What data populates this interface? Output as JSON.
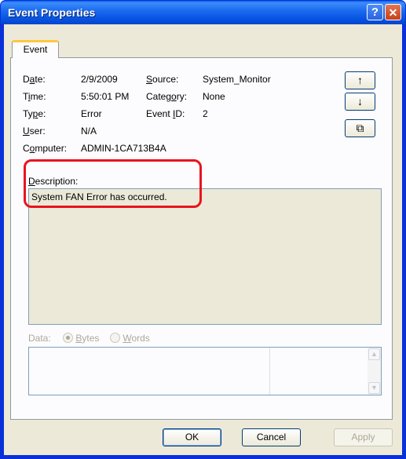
{
  "window": {
    "title": "Event Properties"
  },
  "titlebar": {
    "help_glyph": "?",
    "close_glyph": "✕"
  },
  "tabs": [
    {
      "label": "Event"
    }
  ],
  "fields": {
    "date_label": "Date:",
    "date_value": "2/9/2009",
    "time_label": "Time:",
    "time_value": "5:50:01 PM",
    "type_label": "Type:",
    "type_value": "Error",
    "user_label": "User:",
    "user_value": "N/A",
    "computer_label": "Computer:",
    "computer_value": "ADMIN-1CA713B4A",
    "source_label": "Source:",
    "source_value": "System_Monitor",
    "category_label": "Category:",
    "category_value": "None",
    "eventid_label": "Event ID:",
    "eventid_value": "2"
  },
  "nav_buttons": {
    "up_icon": "↑",
    "down_icon": "↓",
    "copy_icon": "⧉"
  },
  "description": {
    "label": "Description:",
    "text": "System FAN Error has occurred."
  },
  "data": {
    "label": "Data:",
    "bytes_label": "Bytes",
    "words_label": "Words",
    "selected": "Bytes"
  },
  "buttons": {
    "ok": "OK",
    "cancel": "Cancel",
    "apply": "Apply"
  },
  "colors": {
    "highlight": "#e8141d",
    "title_bar": "#0551e0"
  }
}
